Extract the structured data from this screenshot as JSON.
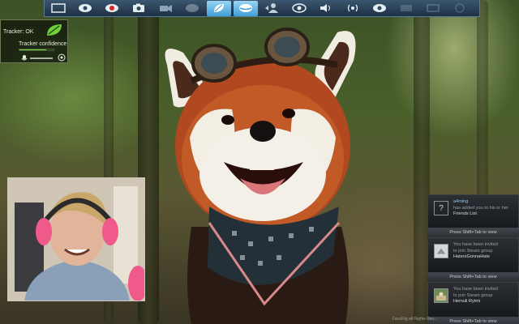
{
  "toolbar": {
    "buttons": [
      {
        "name": "screen-frame-icon",
        "active": false
      },
      {
        "name": "eye-icon",
        "active": false
      },
      {
        "name": "eye-red-icon",
        "active": false
      },
      {
        "name": "camera-icon",
        "active": false
      },
      {
        "name": "video-camera-icon",
        "active": false
      },
      {
        "name": "eye-dim-icon",
        "active": false
      },
      {
        "name": "leaf-icon",
        "active": true
      },
      {
        "name": "mouth-icon",
        "active": true
      },
      {
        "name": "user-swap-icon",
        "active": false
      },
      {
        "name": "eye-outline-icon",
        "active": false
      },
      {
        "name": "speaker-icon",
        "active": false
      },
      {
        "name": "broadcast-icon",
        "active": false
      },
      {
        "name": "eye-settings-icon",
        "active": false
      },
      {
        "name": "blank-icon",
        "active": false
      },
      {
        "name": "film-icon",
        "active": false
      },
      {
        "name": "circle-icon",
        "active": false
      }
    ]
  },
  "tracker": {
    "status": "Tracker: OK",
    "confidence_label": "Tracker confidence",
    "confidence": 0.78,
    "accent": "#6fcf3a"
  },
  "notifications": [
    {
      "user": "a4ming",
      "message": "has added you to his or her",
      "detail": "Friends List",
      "avatar": "question-icon"
    },
    {
      "press": "Press Shift+Tab to view"
    },
    {
      "message": "You have been invited",
      "message2": "to join Steam group",
      "detail": "HatersGonnaHate",
      "avatar": "group-icon"
    },
    {
      "press": "Press Shift+Tab to view"
    },
    {
      "message": "You have been invited",
      "message2": "to join Steam group",
      "detail": "Hemuli Rytmi",
      "avatar": "group-photo-icon"
    },
    {
      "press": "Press Shift+Tab to view"
    }
  ],
  "watermark": "FaceRig all Rights Res..."
}
